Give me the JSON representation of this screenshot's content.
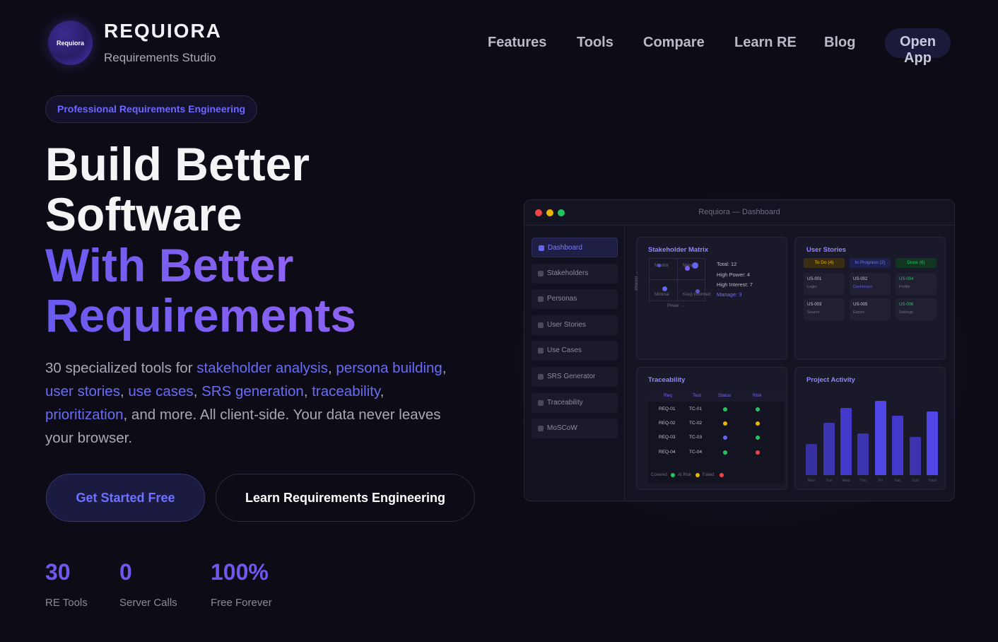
{
  "header": {
    "logo_text": "Requiora",
    "brand": "REQUIORA",
    "tagline": "Requirements Studio",
    "nav": [
      "Features",
      "Tools",
      "Compare",
      "Learn RE",
      "Blog"
    ],
    "open_app": "Open App"
  },
  "hero": {
    "pill": "Professional Requirements Engineering",
    "title_line1": "Build Better",
    "title_line2": "Software",
    "title_line3": "With Better",
    "title_line4": "Requirements",
    "desc": {
      "t1": "30 specialized tools for ",
      "l1": "stakeholder analysis",
      "c1": ", ",
      "l2": "persona building",
      "c2": ", ",
      "l3": "user stories",
      "c3": ", ",
      "l4": "use cases",
      "c4": ", ",
      "l5": "SRS generation",
      "c5": ", ",
      "l6": "traceability",
      "c6": ", ",
      "l7": "prioritization",
      "t2": ", and more. All client-side. Your data never leaves your browser."
    },
    "cta_primary": "Get Started Free",
    "cta_secondary": "Learn Requirements Engineering",
    "stats": [
      {
        "value": "30",
        "label": "RE Tools"
      },
      {
        "value": "0",
        "label": "Server Calls"
      },
      {
        "value": "100%",
        "label": "Free Forever"
      }
    ]
  },
  "dashboard": {
    "window_title": "Requiora — Dashboard",
    "sidebar": [
      "Dashboard",
      "Stakeholders",
      "Personas",
      "User Stories",
      "Use Cases",
      "SRS Generator",
      "Traceability",
      "MoSCoW"
    ],
    "stakeholder": {
      "title": "Stakeholder Matrix",
      "quadrants": [
        "Monitor",
        "Manage",
        "Minimal",
        "Keep Informed"
      ],
      "axis_x": "Power →",
      "axis_y": "Interest →",
      "total": "Total: 12",
      "high_power": "High Power: 4",
      "high_interest": "High Interest: 7",
      "manage": "Manage: 3"
    },
    "user_stories": {
      "title": "User Stories",
      "columns": [
        "To Do (4)",
        "In Progress (2)",
        "Done (6)"
      ],
      "cards": [
        {
          "id": "US-001",
          "name": "Login"
        },
        {
          "id": "US-002",
          "name": "Dashboard"
        },
        {
          "id": "US-004",
          "name": "Profile"
        },
        {
          "id": "US-003",
          "name": "Search"
        },
        {
          "id": "US-005",
          "name": "Export"
        },
        {
          "id": "US-006",
          "name": "Settings"
        }
      ]
    },
    "traceability": {
      "title": "Traceability",
      "headers": [
        "Req",
        "Test",
        "Status",
        "Risk"
      ],
      "rows": [
        {
          "req": "REQ-01",
          "test": "TC-01",
          "status": "#22c55e",
          "risk": "#22c55e"
        },
        {
          "req": "REQ-02",
          "test": "TC-02",
          "status": "#eab308",
          "risk": "#eab308"
        },
        {
          "req": "REQ-03",
          "test": "TC-03",
          "status": "#6366f1",
          "risk": "#22c55e"
        },
        {
          "req": "REQ-04",
          "test": "TC-04",
          "status": "#22c55e",
          "risk": "#ef4444"
        }
      ],
      "legend": [
        "Covered",
        "At Risk",
        "Failed"
      ]
    },
    "activity": {
      "title": "Project Activity",
      "days": [
        "Mon",
        "Tue",
        "Wed",
        "Thu",
        "Fri",
        "Sat",
        "Sun",
        "Total"
      ]
    }
  },
  "colors": {
    "accent": "#6366f1",
    "purple": "#7a5cf0",
    "background": "#0d0c16"
  }
}
